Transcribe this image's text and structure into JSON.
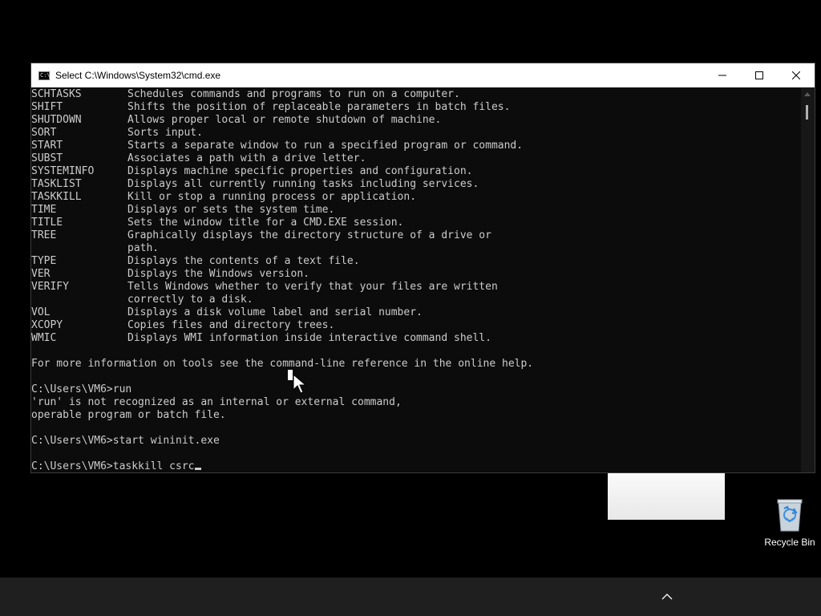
{
  "window": {
    "title": "Select C:\\Windows\\System32\\cmd.exe",
    "icon": "console-app-icon",
    "icon_glyph": "C:\\",
    "controls": [
      "minimize-icon",
      "maximize-icon",
      "close-icon"
    ]
  },
  "console": {
    "commands": [
      {
        "name": "SCHTASKS",
        "desc": "Schedules commands and programs to run on a computer."
      },
      {
        "name": "SHIFT",
        "desc": "Shifts the position of replaceable parameters in batch files."
      },
      {
        "name": "SHUTDOWN",
        "desc": "Allows proper local or remote shutdown of machine."
      },
      {
        "name": "SORT",
        "desc": "Sorts input."
      },
      {
        "name": "START",
        "desc": "Starts a separate window to run a specified program or command."
      },
      {
        "name": "SUBST",
        "desc": "Associates a path with a drive letter."
      },
      {
        "name": "SYSTEMINFO",
        "desc": "Displays machine specific properties and configuration."
      },
      {
        "name": "TASKLIST",
        "desc": "Displays all currently running tasks including services."
      },
      {
        "name": "TASKKILL",
        "desc": "Kill or stop a running process or application."
      },
      {
        "name": "TIME",
        "desc": "Displays or sets the system time."
      },
      {
        "name": "TITLE",
        "desc": "Sets the window title for a CMD.EXE session."
      },
      {
        "name": "TREE",
        "desc": "Graphically displays the directory structure of a drive or"
      },
      {
        "name": "",
        "desc": "path."
      },
      {
        "name": "TYPE",
        "desc": "Displays the contents of a text file."
      },
      {
        "name": "VER",
        "desc": "Displays the Windows version."
      },
      {
        "name": "VERIFY",
        "desc": "Tells Windows whether to verify that your files are written"
      },
      {
        "name": "",
        "desc": "correctly to a disk."
      },
      {
        "name": "VOL",
        "desc": "Displays a disk volume label and serial number."
      },
      {
        "name": "XCOPY",
        "desc": "Copies files and directory trees."
      },
      {
        "name": "WMIC",
        "desc": "Displays WMI information inside interactive command shell."
      }
    ],
    "info_line": "For more information on tools see the command-line reference in the online help.",
    "prompt1": "C:\\Users\\VM6>run",
    "error1": "'run' is not recognized as an internal or external command,",
    "error2": "operable program or batch file.",
    "prompt2": "C:\\Users\\VM6>start wininit.exe",
    "prompt3": "C:\\Users\\VM6>taskkill csrc"
  },
  "desktop": {
    "recycle_bin_label": "Recycle Bin",
    "recycle_bin_icon": "recycle-bin-icon"
  },
  "taskbar": {
    "tray_icon": "chevron-up-icon"
  }
}
